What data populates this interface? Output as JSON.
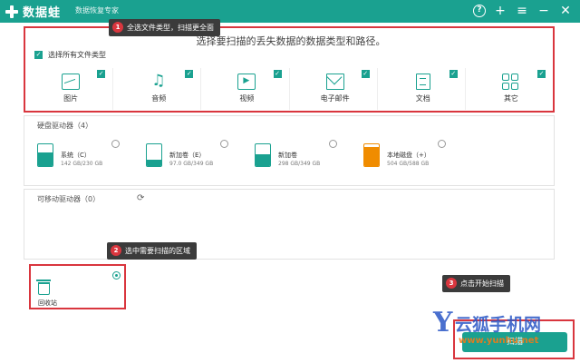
{
  "app": {
    "name": "数据蛙",
    "subtitle": "数据恢复专家",
    "icons": [
      "help-icon",
      "plus-icon",
      "menu-icon",
      "minimize-icon",
      "close-icon"
    ],
    "accent": "#1aa190",
    "highlight": "#d9363e"
  },
  "file_section": {
    "title": "选择要扫描的丢失数据的数据类型和路径。",
    "select_all_label": "选择所有文件类型",
    "select_all_checked": true,
    "types": [
      {
        "label": "图片",
        "icon": "image-icon",
        "checked": true
      },
      {
        "label": "音频",
        "icon": "music-icon",
        "checked": true
      },
      {
        "label": "视频",
        "icon": "video-icon",
        "checked": true
      },
      {
        "label": "电子邮件",
        "icon": "mail-icon",
        "checked": true
      },
      {
        "label": "文档",
        "icon": "document-icon",
        "checked": true
      },
      {
        "label": "其它",
        "icon": "grid-icon",
        "checked": true
      }
    ]
  },
  "tips": {
    "tip1": {
      "num": "1",
      "text": "全选文件类型，扫描更全面"
    },
    "tip2": {
      "num": "2",
      "text": "选中需要扫描的区域"
    },
    "tip3": {
      "num": "3",
      "text": "点击开始扫描"
    }
  },
  "drives": {
    "title": "硬盘驱动器（4）",
    "items": [
      {
        "name": "系统（C）",
        "size": "142 GB/230 GB",
        "used": 0.62,
        "color": "#1aa190"
      },
      {
        "name": "新加卷（E）",
        "size": "97.0 GB/349 GB",
        "used": 0.28,
        "color": "#1aa190"
      },
      {
        "name": "新加卷",
        "size": "298 GB/349 GB",
        "used": 0.55,
        "color": "#1aa190"
      },
      {
        "name": "本地磁盘（+）",
        "size": "504 GB/588 GB",
        "used": 0.86,
        "color": "#f08c00"
      }
    ]
  },
  "removable": {
    "title": "可移动驱动器（0）"
  },
  "recycle": {
    "label": "回收站",
    "selected": true
  },
  "scan_button": {
    "label": "扫描"
  },
  "watermark": {
    "logo": "Y",
    "brand": "云狐手机网",
    "url": "www.yunhu.net"
  }
}
